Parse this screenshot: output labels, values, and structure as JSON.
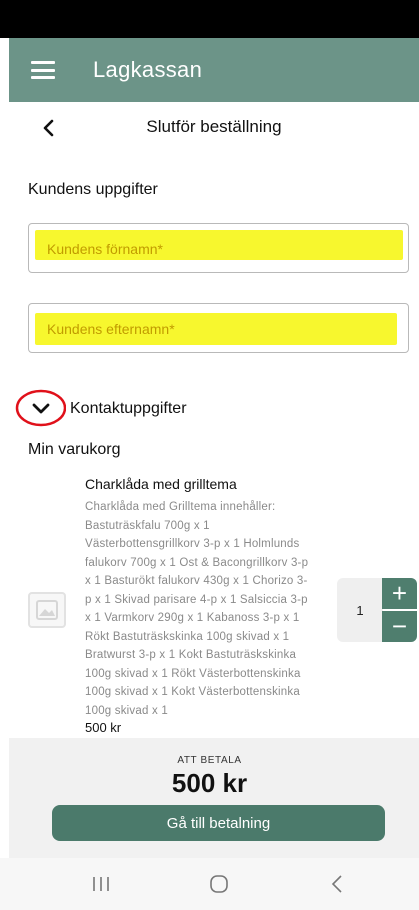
{
  "app": {
    "title": "Lagkassan"
  },
  "header": {
    "title": "Slutför beställning"
  },
  "customer": {
    "section_title": "Kundens uppgifter",
    "first_name": {
      "placeholder": "Kundens förnamn*",
      "value": ""
    },
    "last_name": {
      "placeholder": "Kundens efternamn*",
      "value": ""
    },
    "contact_label": "Kontaktuppgifter"
  },
  "cart": {
    "title": "Min varukorg",
    "items": [
      {
        "name": "Charklåda med grilltema",
        "description_lines": [
          "Charklåda med Grilltema innehåller:",
          "Bastuträskfalu 700g x 1",
          "Västerbottensgrillkorv 3-p x 1 Holmlunds",
          "falukorv 700g x 1 Ost & Bacongrillkorv 3-p",
          "x 1 Basturökt falukorv 430g x 1 Chorizo 3-",
          "p x 1 Skivad parisare 4-p x 1 Salsiccia 3-p",
          "x 1 Varmkorv 290g x 1 Kabanoss 3-p x 1",
          "Rökt Bastuträskskinka 100g skivad x 1",
          "Bratwurst 3-p x 1 Kokt Bastuträskskinka",
          "100g skivad x 1 Rökt Västerbottenskinka",
          "100g skivad x 1 Kokt Västerbottenskinka",
          "100g skivad x 1"
        ],
        "price": "500 kr",
        "quantity": "1",
        "plus_symbol": "+",
        "minus_symbol": "−"
      }
    ]
  },
  "footer": {
    "to_pay_label": "ATT BETALA",
    "total": "500 kr",
    "pay_button": "Gå till betalning"
  },
  "annotations": {
    "highlight_color": "#f7f72e",
    "circle_color": "#e0101a"
  },
  "colors": {
    "app_bar": "#6c9488",
    "accent": "#4b7a6b"
  },
  "icons": [
    "menu-icon",
    "back-icon",
    "chevron-down-icon",
    "image-placeholder-icon",
    "recent-apps-icon",
    "home-icon",
    "back-nav-icon"
  ]
}
